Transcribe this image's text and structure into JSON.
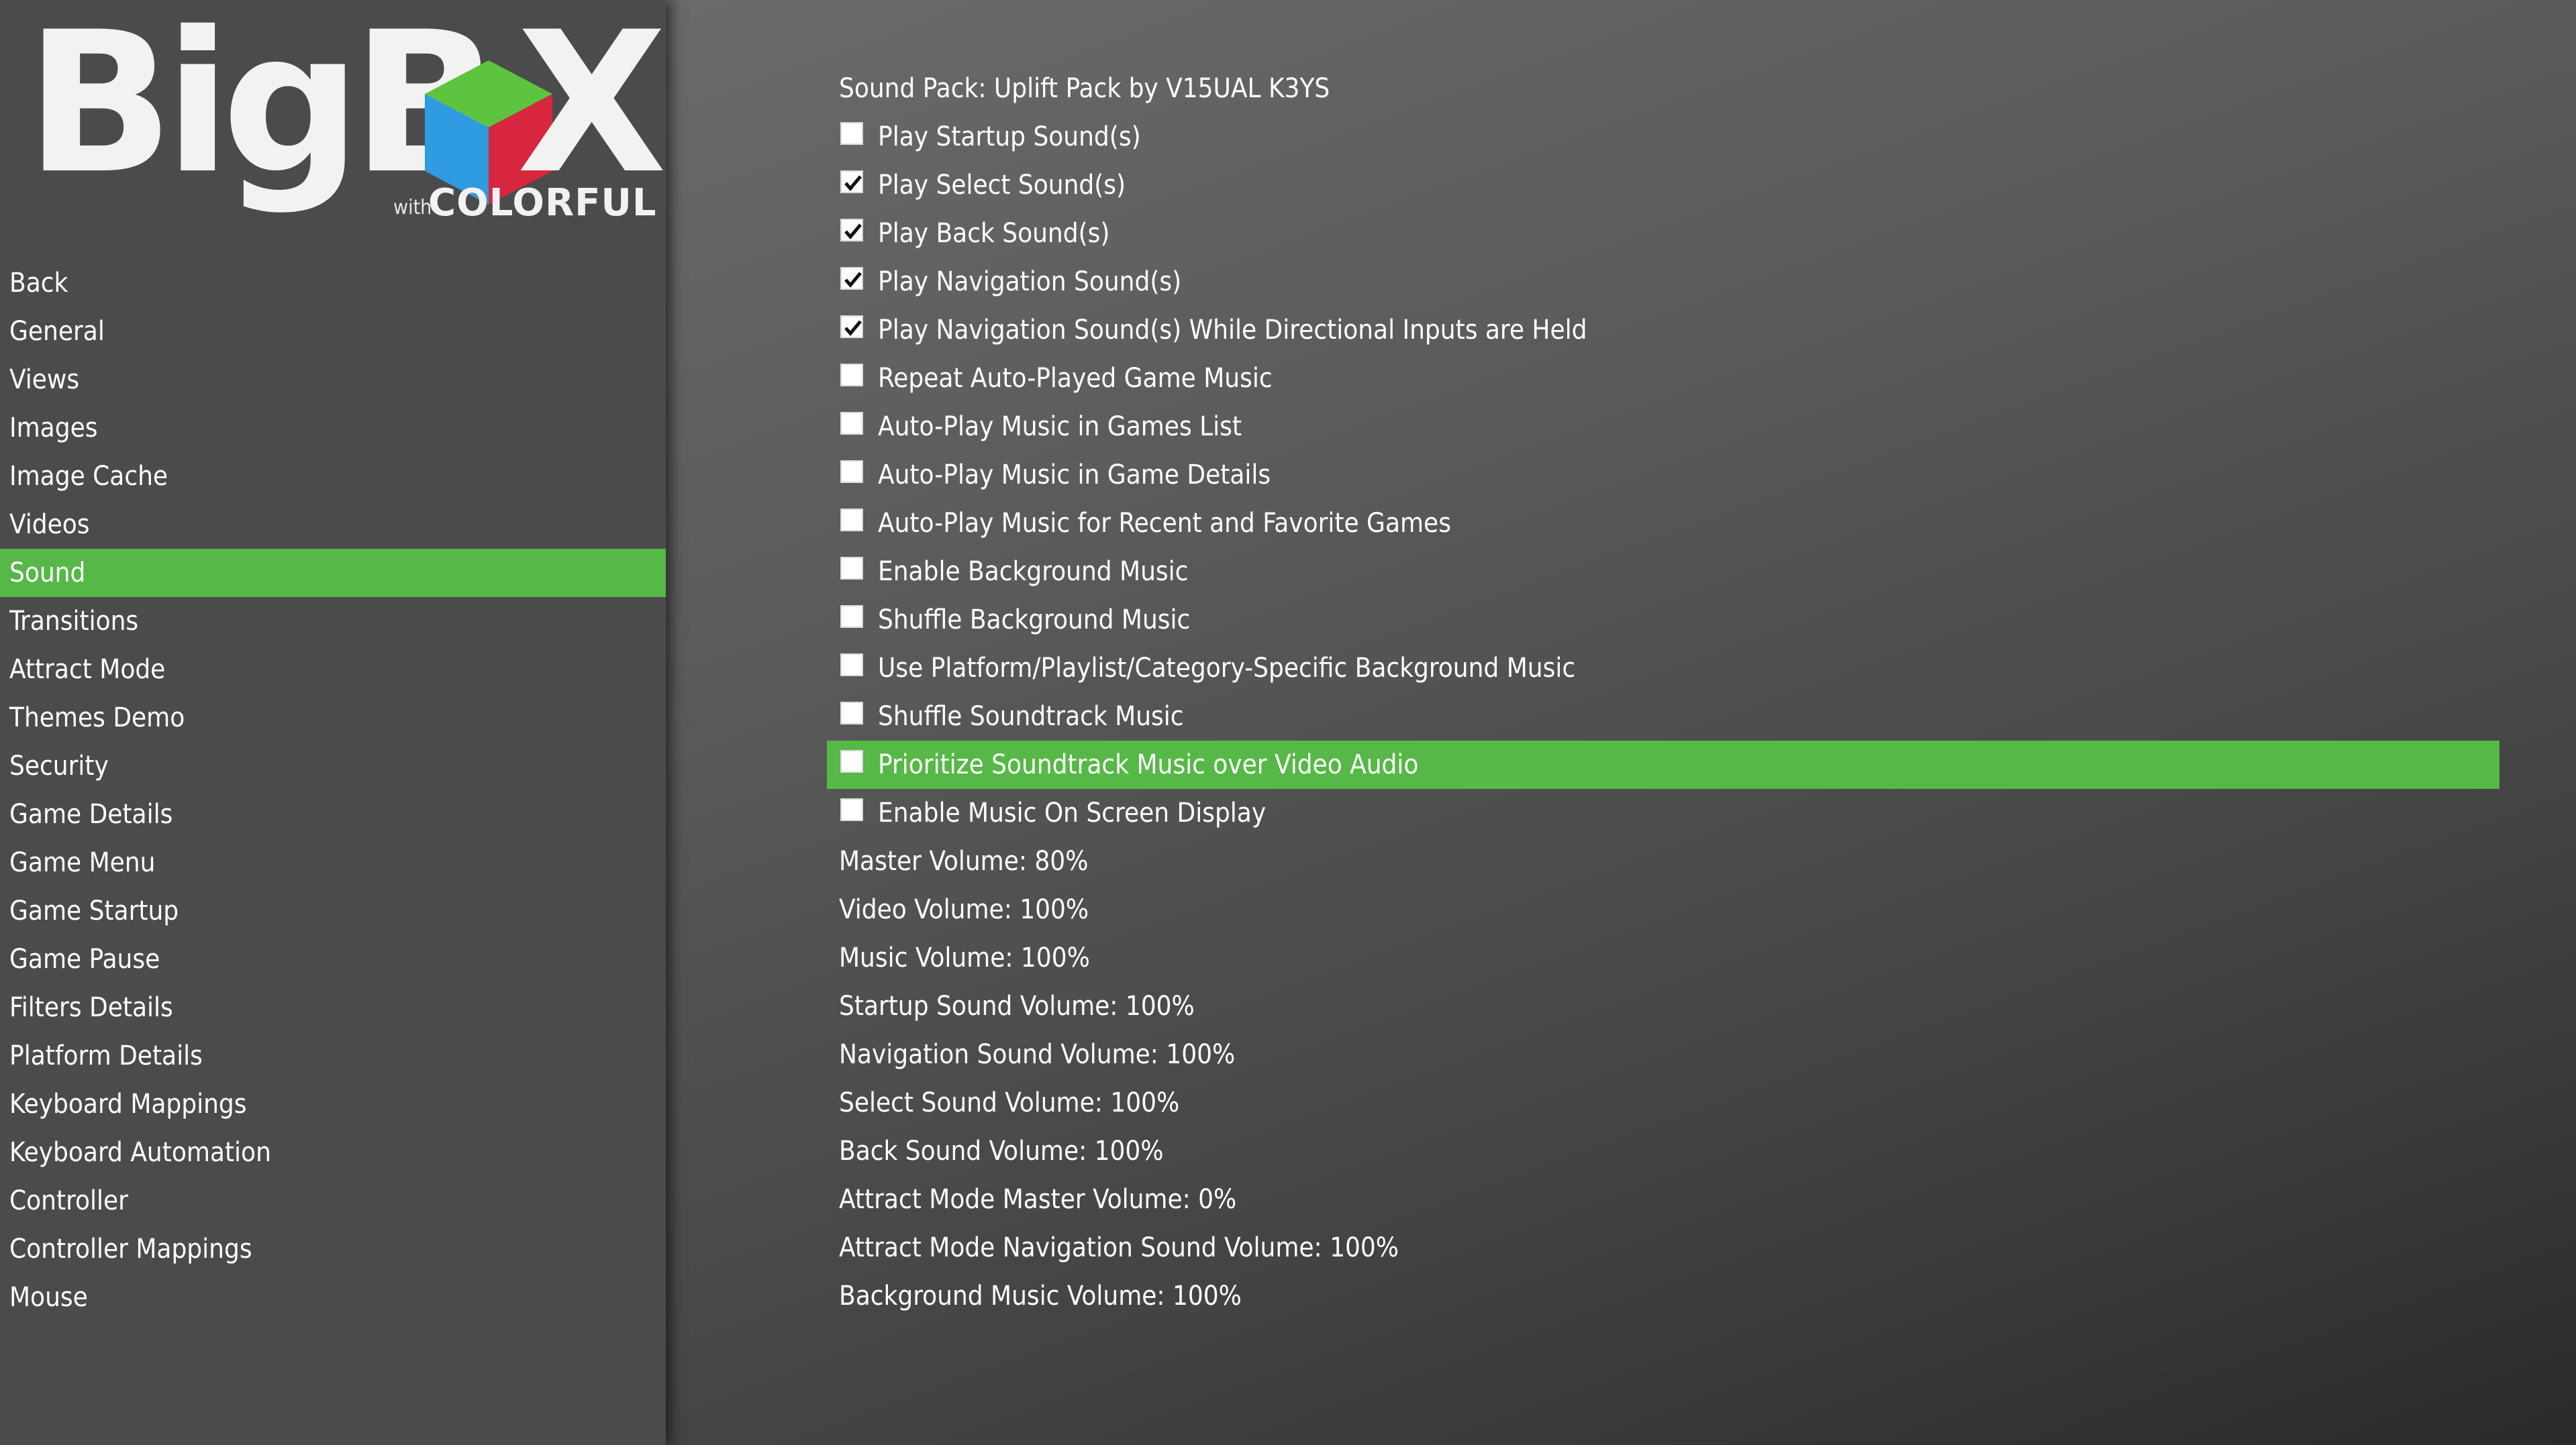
{
  "brand": {
    "word_left": "BigB",
    "word_right": "X",
    "with_text": "with",
    "sub_brand": "COLORFUL",
    "cube_colors": {
      "top": "#5cc43f",
      "left": "#2f9be0",
      "right": "#d7263d"
    }
  },
  "theme": {
    "accent": "#56b846",
    "sidebar_bg": "#4b4b4b"
  },
  "sidebar": {
    "active_index": 6,
    "items": [
      {
        "label": "Back"
      },
      {
        "label": "General"
      },
      {
        "label": "Views"
      },
      {
        "label": "Images"
      },
      {
        "label": "Image Cache"
      },
      {
        "label": "Videos"
      },
      {
        "label": "Sound"
      },
      {
        "label": "Transitions"
      },
      {
        "label": "Attract Mode"
      },
      {
        "label": "Themes Demo"
      },
      {
        "label": "Security"
      },
      {
        "label": "Game Details"
      },
      {
        "label": "Game Menu"
      },
      {
        "label": "Game Startup"
      },
      {
        "label": "Game Pause"
      },
      {
        "label": "Filters Details"
      },
      {
        "label": "Platform Details"
      },
      {
        "label": "Keyboard Mappings"
      },
      {
        "label": "Keyboard Automation"
      },
      {
        "label": "Controller"
      },
      {
        "label": "Controller Mappings"
      },
      {
        "label": "Mouse"
      }
    ]
  },
  "settings": {
    "active_index": 14,
    "items": [
      {
        "label": "Sound Pack: Uplift Pack by V15UAL K3YS",
        "type": "value"
      },
      {
        "label": "Play Startup Sound(s)",
        "type": "checkbox",
        "checked": false
      },
      {
        "label": "Play Select Sound(s)",
        "type": "checkbox",
        "checked": true
      },
      {
        "label": "Play Back Sound(s)",
        "type": "checkbox",
        "checked": true
      },
      {
        "label": "Play Navigation Sound(s)",
        "type": "checkbox",
        "checked": true
      },
      {
        "label": "Play Navigation Sound(s) While Directional Inputs are Held",
        "type": "checkbox",
        "checked": true
      },
      {
        "label": "Repeat Auto-Played Game Music",
        "type": "checkbox",
        "checked": false
      },
      {
        "label": "Auto-Play Music in Games List",
        "type": "checkbox",
        "checked": false
      },
      {
        "label": "Auto-Play Music in Game Details",
        "type": "checkbox",
        "checked": false
      },
      {
        "label": "Auto-Play Music for Recent and Favorite Games",
        "type": "checkbox",
        "checked": false
      },
      {
        "label": "Enable Background Music",
        "type": "checkbox",
        "checked": false
      },
      {
        "label": "Shuffle Background Music",
        "type": "checkbox",
        "checked": false
      },
      {
        "label": "Use Platform/Playlist/Category-Specific Background Music",
        "type": "checkbox",
        "checked": false
      },
      {
        "label": "Shuffle Soundtrack Music",
        "type": "checkbox",
        "checked": false
      },
      {
        "label": "Prioritize Soundtrack Music over Video Audio",
        "type": "checkbox",
        "checked": false
      },
      {
        "label": "Enable Music On Screen Display",
        "type": "checkbox",
        "checked": false
      },
      {
        "label": "Master Volume: 80%",
        "type": "value"
      },
      {
        "label": "Video Volume: 100%",
        "type": "value"
      },
      {
        "label": "Music Volume: 100%",
        "type": "value"
      },
      {
        "label": "Startup Sound Volume: 100%",
        "type": "value"
      },
      {
        "label": "Navigation Sound Volume: 100%",
        "type": "value"
      },
      {
        "label": "Select Sound Volume: 100%",
        "type": "value"
      },
      {
        "label": "Back Sound Volume: 100%",
        "type": "value"
      },
      {
        "label": "Attract Mode Master Volume: 0%",
        "type": "value"
      },
      {
        "label": "Attract Mode Navigation Sound Volume: 100%",
        "type": "value"
      },
      {
        "label": "Background Music Volume: 100%",
        "type": "value"
      }
    ]
  }
}
